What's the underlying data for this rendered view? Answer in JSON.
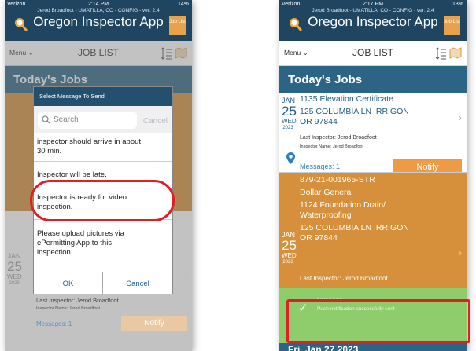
{
  "status": {
    "carrier": "Verizon",
    "left_time": "2:14 PM",
    "left_battery": "14%",
    "right_time": "2:17 PM",
    "right_battery": "13%"
  },
  "app": {
    "subtitle": "Jerod Broadfoot - UMATILLA, CO - CONFIG - ver: 2.4",
    "title": "Oregon Inspector App",
    "job_list_button": "Job List"
  },
  "toolbar": {
    "menu": "Menu ⌄",
    "title": "JOB LIST"
  },
  "section": {
    "today": "Today's Jobs",
    "next": "Fri, Jan 27 2023"
  },
  "job1": {
    "month": "JAN",
    "day": "25",
    "dow": "WED",
    "year": "2023",
    "title": "1135 Elevation Certificate",
    "addr1": "125 COLUMBIA LN IRRIGON",
    "addr2": "OR 97844",
    "last": "Last Inspector:  Jerod Broadfoot",
    "insp": "Inspector Name: Jerod Broadfoot",
    "messages": "Messages: 1",
    "notify": "Notify"
  },
  "job2": {
    "month": "JAN",
    "day": "25",
    "dow": "WED",
    "year": "2023",
    "permit": "879-21-001965-STR",
    "owner": "Dollar General",
    "work1": "1124 Foundation Drain/",
    "work2": "Waterproofing",
    "addr1": "125 COLUMBIA LN IRRIGON",
    "addr2": "OR 97844",
    "last": "Last Inspector:  Jerod Broadfoot"
  },
  "toast": {
    "title": "Success",
    "text": "Push notification successfully sent"
  },
  "dialog": {
    "title": "Select Message To Send",
    "search_placeholder": "Search",
    "search_cancel": "Cancel",
    "items": [
      {
        "l1": "inspector should arrive in about",
        "l2": "30 min."
      },
      {
        "l1": "Inspector will be late.",
        "l2": ""
      },
      {
        "l1": "Inspector is ready for video",
        "l2": "inspection."
      },
      {
        "l1": "Please upload pictures via",
        "l2": "ePermitting App to this",
        "l3": "inspection."
      }
    ],
    "ok": "OK",
    "cancel": "Cancel"
  },
  "bg": {
    "month": "JAN",
    "day": "25",
    "dow": "WED",
    "year": "2023",
    "last": "Last Inspector:  Jerod Broadfoot",
    "insp": "Inspector Name: Jerod Broadfoot",
    "messages": "Messages: 1",
    "notify": "Notify"
  },
  "colors": {
    "header": "#1f4560",
    "section": "#2b6485",
    "orange": "#ef9b45",
    "success": "#8fcc6c",
    "highlight": "#e01e26"
  }
}
